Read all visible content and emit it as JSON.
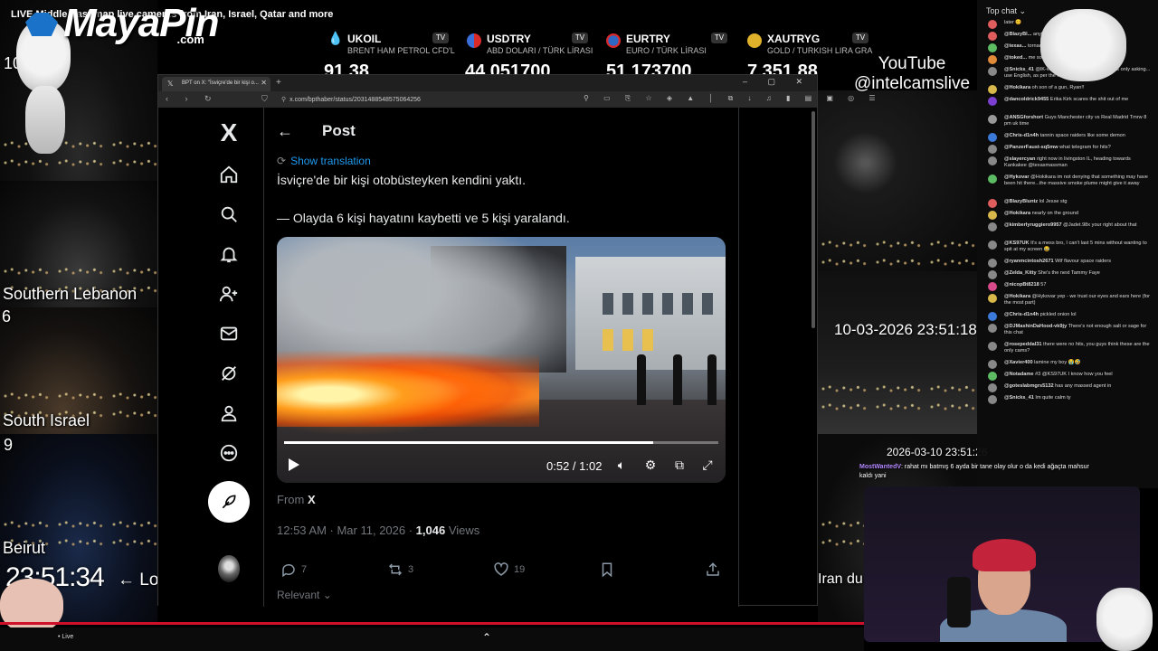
{
  "top_title": "LIVE Middle East map live cameras from Iran, Israel, Qatar and more",
  "logo": {
    "name": "MayaPin",
    "suffix": ".com"
  },
  "tickers": [
    {
      "symbol": "UKOIL",
      "subtitle": "BRENT HAM PETROL CFD'L",
      "value": "91,38",
      "color": "#eeeeee"
    },
    {
      "symbol": "USDTRY",
      "subtitle": "ABD DOLARI / TÜRK LİRASI",
      "value": "44,051700",
      "color": "#3a6fd8"
    },
    {
      "symbol": "EURTRY",
      "subtitle": "EURO / TÜRK LİRASI",
      "value": "51,173700",
      "color": "#2f67c4"
    },
    {
      "symbol": "XAUTRYG",
      "subtitle": "GOLD / TURKISH LIRA GRA",
      "value": "7.351,88",
      "color": "#e0b12a"
    }
  ],
  "youtube_label": {
    "line1": "YouTube",
    "line2": "@intelcamslive"
  },
  "cameras": {
    "top_left_number": "10",
    "southern_lebanon": {
      "label": "Southern Lebanon",
      "number": "6"
    },
    "south_israel": {
      "label": "South Israel",
      "number": "9"
    },
    "beirut": {
      "label": "Beirut"
    },
    "clock": "23:51:34",
    "clock_arrow": "← Lo",
    "right_timestamp": "10-03-2026 23:51:18",
    "right_timestamp2": "2026-03-10 23:51:26",
    "iran_label": "Iran du"
  },
  "browser": {
    "tab_title": "BPT on X: \"İsviçre'de bir kişi o...",
    "url": "x.com/bpthaber/status/2031488548575064256"
  },
  "x_nav": {
    "logo": "X",
    "items": [
      "home-icon",
      "explore-icon",
      "notifications-icon",
      "communities-icon",
      "messages-icon",
      "grok-icon",
      "profile-icon",
      "more-icon"
    ]
  },
  "post": {
    "header_title": "Post",
    "show_translation": "Show translation",
    "text_line1": "İsviçre'de bir kişi otobüsteyken kendini yaktı.",
    "text_line2": "— Olayda 6 kişi hayatını kaybetti ve 5 kişi yaralandı.",
    "video": {
      "current_time": "0:52",
      "duration": "1:02",
      "time_display": "0:52 / 1:02",
      "progress": 0.85
    },
    "from_prefix": "From",
    "from_source": "X",
    "meta_time": "12:53 AM · Mar 11, 2026 · ",
    "views_count": "1,046",
    "views_label": " Views",
    "actions": {
      "replies": "7",
      "reposts": "3",
      "likes": "19"
    },
    "relevant": "Relevant"
  },
  "chat": {
    "header": "Top chat",
    "messages": [
      {
        "user": "",
        "text": "later 😊",
        "color": "#e05d5d"
      },
      {
        "user": "@BlazyBl...",
        "text": "anything u",
        "color": "#e05d5d"
      },
      {
        "user": "@texas...",
        "text": "tornado ... are the",
        "color": "#5dbb63"
      },
      {
        "user": "@toked...",
        "text": "me some ...",
        "color": "#e08a3a"
      },
      {
        "user": "@Snicks_41",
        "text": "@lK-vf... sorry you feel that way. Was only asking... use English, as per the rules",
        "color": "#888"
      },
      {
        "user": "@Hokikara",
        "text": "oh son of a gun, Ryan!!",
        "color": "#d8b84a"
      },
      {
        "user": "@dancoldrick9455",
        "text": "Erika Kirk scares the shit out of me",
        "color": "#7a3fd0"
      },
      {
        "user": "@ANSGforshort",
        "text": "Guys Manchester city vs Real Madrid Tmrw 8 pm uk time",
        "color": "#999"
      },
      {
        "user": "@Chris-d1n4h",
        "text": "tannin space raiders like some demon",
        "color": "#3b7ad8"
      },
      {
        "user": "@PanzerFaust-sq5mw",
        "text": "what telegram for hits?",
        "color": "#888"
      },
      {
        "user": "@slayercyan",
        "text": "right now in livingston IL, heading towards Kankakee @texasmassman",
        "color": "#888"
      },
      {
        "user": "@Hykovar",
        "text": "@Hokikara im not denying that something may have been hit there...the massive smoke plume might give it away",
        "color": "#5dbb63"
      },
      {
        "user": "@BlazyBluntz",
        "text": "lol Jesse stg",
        "color": "#e05d5d"
      },
      {
        "user": "@Hokikara",
        "text": "nearly on the ground",
        "color": "#d8b84a"
      },
      {
        "user": "@kimberlyruggiero9957",
        "text": "@Jadet.98x your right about that",
        "color": "#888"
      },
      {
        "user": "@KS97UK",
        "text": "It's a mess bro, I can't last 5 mins without wanting to spit at my screen 😂",
        "color": "#888"
      },
      {
        "user": "@ryanmcintosh2671",
        "text": "Wtf flavour space raiders",
        "color": "#888"
      },
      {
        "user": "@Zelda_Kitty",
        "text": "She's the next Tammy Faye",
        "color": "#888"
      },
      {
        "user": "@nicopBt8218",
        "text": "57",
        "color": "#d94a8a"
      },
      {
        "user": "@Hokikara",
        "text": "@Hykovar yep - we trust our eyes and ears here (for the most part)",
        "color": "#d8b84a"
      },
      {
        "user": "@Chris-d1n4h",
        "text": "pickled onion lol",
        "color": "#3b7ad8"
      },
      {
        "user": "@DJMashinDaHood-vk9jy",
        "text": "There's not enough salt or sage for this chat",
        "color": "#888"
      },
      {
        "user": "@rosepeddal31",
        "text": "there were no hits, you guys think these are the only cams?",
        "color": "#888"
      },
      {
        "user": "@Xavier400",
        "text": "lamine my boy 😭🤣",
        "color": "#888"
      },
      {
        "user": "@Notadame",
        "text": "#3 @KS97UK I know how you feel",
        "color": "#5dbb63"
      },
      {
        "user": "@goteslabmgrs5132",
        "text": "has any massed agent in",
        "color": "#888"
      },
      {
        "user": "@Snicks_41",
        "text": "Im quite calm ty",
        "color": "#888"
      }
    ]
  },
  "donation": {
    "user": "MostWantedV",
    "text": ": rahat mı batmış 6 ayda bir tane olay olur o da kedi ağaçta mahsur kaldı yani"
  },
  "bottom": {
    "live_label": "• Live"
  }
}
